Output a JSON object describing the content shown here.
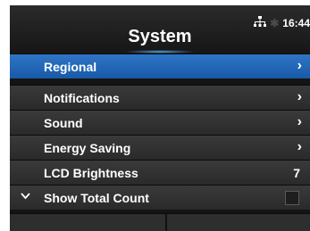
{
  "header": {
    "title": "System",
    "time": "16:44"
  },
  "list": {
    "items": [
      {
        "label": "Regional",
        "accessory": "chevron",
        "selected": true
      },
      {
        "label": "Notifications",
        "accessory": "chevron"
      },
      {
        "label": "Sound",
        "accessory": "chevron"
      },
      {
        "label": "Energy Saving",
        "accessory": "chevron"
      },
      {
        "label": "LCD Brightness",
        "accessory": "value",
        "value": "7"
      },
      {
        "label": "Show Total Count",
        "accessory": "checkbox",
        "checked": false,
        "expander": true
      }
    ]
  },
  "colors": {
    "selected": "#1f66b8",
    "row": "#333333",
    "background": "#141414",
    "text": "#ffffff"
  }
}
